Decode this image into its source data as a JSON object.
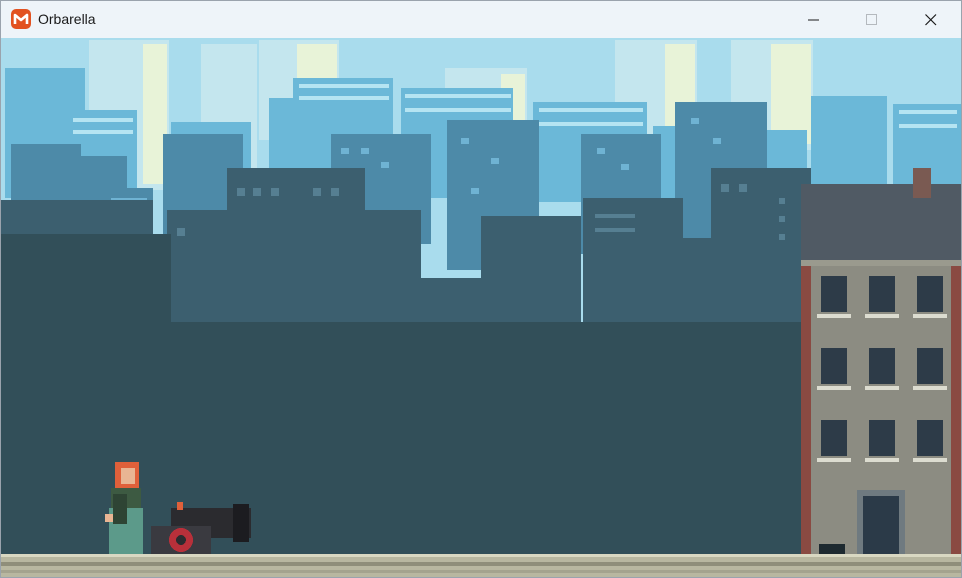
{
  "window": {
    "title": "Orbarella",
    "app_icon": "monogame-logo-icon",
    "controls": [
      "minimize-icon",
      "maximize-icon",
      "close-icon"
    ]
  },
  "game": {
    "scene": "city-rooftop",
    "characters": [
      "red-haired-heroine"
    ],
    "objects": [
      "cannon",
      "brick-apartment-building"
    ],
    "colors": {
      "sky": "#a9dced",
      "far_buildings": "#6bb8d8",
      "mid_buildings": "#4d8aa8",
      "near_buildings": "#3c5f6f",
      "front_silhouette": "#324f59",
      "brick_building": "#8c8c82",
      "brick_trim": "#8a4a42",
      "rooftop": "#505a64",
      "ground": "#b8b7a0"
    }
  }
}
